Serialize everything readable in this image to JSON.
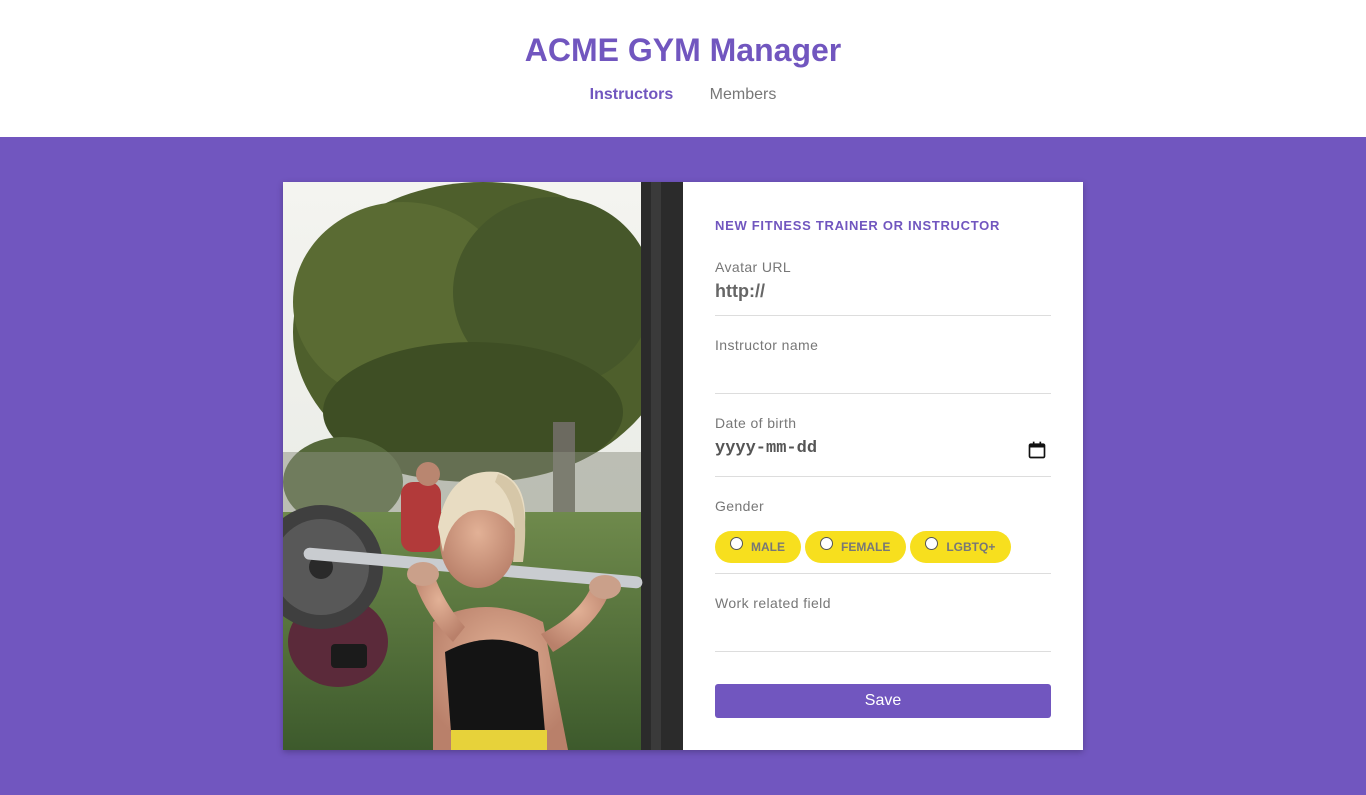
{
  "header": {
    "title": "ACME GYM Manager",
    "nav": [
      {
        "label": "Instructors",
        "active": true
      },
      {
        "label": "Members",
        "active": false
      }
    ]
  },
  "form": {
    "title": "NEW FITNESS TRAINER OR INSTRUCTOR",
    "fields": {
      "avatar": {
        "label": "Avatar URL",
        "placeholder": "http://",
        "value": ""
      },
      "name": {
        "label": "Instructor name",
        "value": ""
      },
      "birth": {
        "label": "Date of birth",
        "placeholder": "yyyy-mm-dd",
        "icon": "calendar-icon"
      },
      "gender": {
        "label": "Gender",
        "options": [
          "MALE",
          "FEMALE",
          "LGBTQ+"
        ]
      },
      "work": {
        "label": "Work related field",
        "value": ""
      }
    },
    "save_label": "Save"
  },
  "colors": {
    "accent": "#7156bf",
    "pill": "#f7df1e",
    "muted_text": "#777777"
  }
}
